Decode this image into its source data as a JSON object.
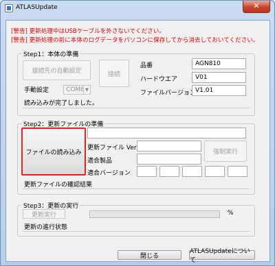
{
  "window": {
    "title": "ATLASUpdate",
    "close_glyph": "✕"
  },
  "warnings": [
    "[警告] 更新処理中はUSBケーブルを外さないでください。",
    "[警告] 更新処理の前に本体のログデータをパソコンに保存してから消去しておいてください。"
  ],
  "step1": {
    "legend": "Step1：本体の準備",
    "auto_connect_label": "接続先の自動設定",
    "connect_label": "接続",
    "manual_label": "手動設定",
    "port_value": "COM8",
    "fields": [
      {
        "label": "品番",
        "value": "AGN810"
      },
      {
        "label": "ハードウエア",
        "value": "V01"
      },
      {
        "label": "ファイルバージョン",
        "value": "V1.01"
      }
    ],
    "status": "読み込みが完了しました。"
  },
  "step2": {
    "legend": "Step2：更新ファイルの準備",
    "load_file_label": "ファイルの読み込み",
    "file_path_value": "",
    "update_ver_label": "更新ファイル Ver",
    "update_ver_value": "",
    "force_run_label": "強制実行",
    "product_label": "適合製品",
    "product_value": "",
    "compat_version_label": "適合バージョン",
    "compat_versions": [
      "",
      "",
      "",
      "",
      "",
      ""
    ],
    "result": "更新ファイルの確認結果"
  },
  "step3": {
    "legend": "Step3：更新の実行",
    "run_label": "更新実行",
    "progress_percent": 0,
    "percent_sign": "%",
    "status": "更新の進行状態"
  },
  "footer": {
    "close_label": "閉じる",
    "about_label": "ATLASUpdateについて"
  }
}
